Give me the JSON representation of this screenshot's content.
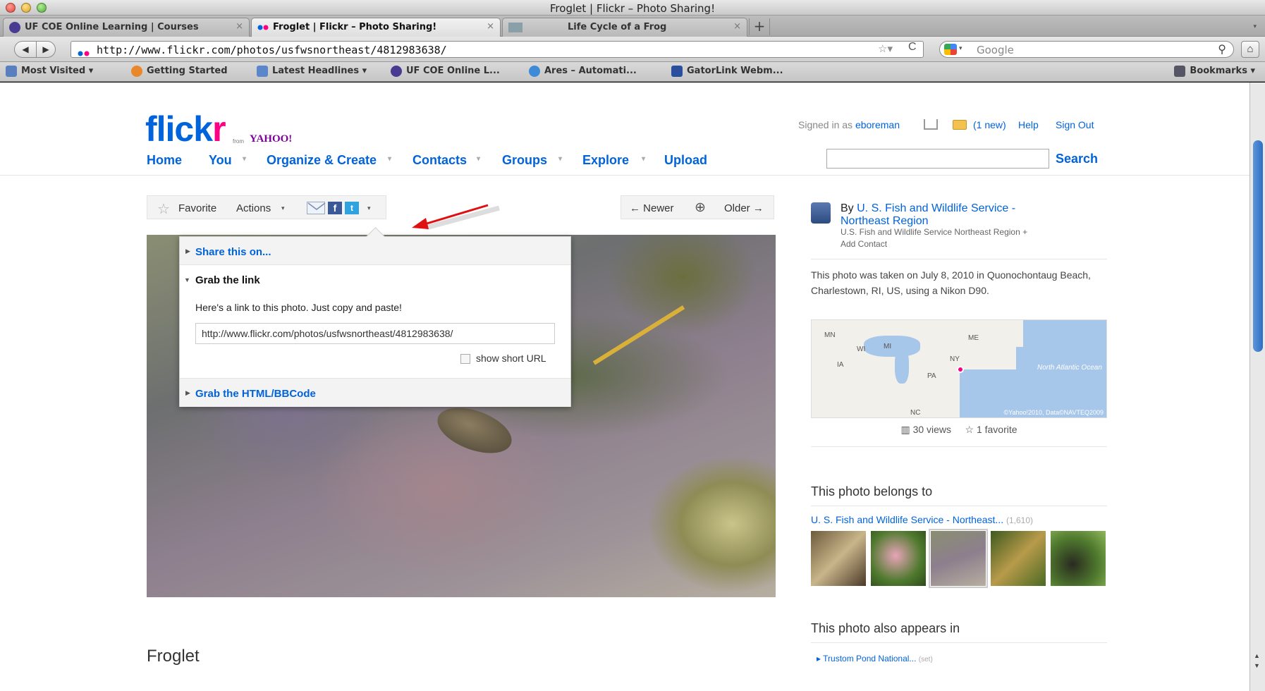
{
  "window": {
    "title": "Froglet | Flickr – Photo Sharing!"
  },
  "tabs": [
    {
      "label": "UF COE Online Learning | Courses",
      "close": "×"
    },
    {
      "label": "Froglet | Flickr – Photo Sharing!",
      "close": "×"
    },
    {
      "label": "Life Cycle of a Frog",
      "close": "×"
    }
  ],
  "tab_new": "+",
  "nav": {
    "back": "◀",
    "forward": "▶",
    "url": "http://www.flickr.com/photos/usfwsnortheast/4812983638/",
    "star": "☆▾",
    "reload": "C",
    "search_placeholder": "Google",
    "search_icon": "⚲",
    "home": "⌂"
  },
  "bookmarks": [
    {
      "label": "Most Visited ▾",
      "icon": "most-visited-icon",
      "color": "#5a7fbf"
    },
    {
      "label": "Getting Started",
      "icon": "firefox-icon",
      "color": "#e8872b"
    },
    {
      "label": "Latest Headlines ▾",
      "icon": "rss-icon",
      "color": "#5b86c9"
    },
    {
      "label": "UF COE Online L...",
      "icon": "uf-coe-icon",
      "color": "#4a3b92"
    },
    {
      "label": "Ares – Automati...",
      "icon": "ares-icon",
      "color": "#3d8ad8"
    },
    {
      "label": "GatorLink Webm...",
      "icon": "uf-icon",
      "color": "#2a4f9e"
    }
  ],
  "bookmarks_menu": "Bookmarks ▾",
  "flickr": {
    "logo_a": "flick",
    "logo_b": "r",
    "logo_from": "from",
    "logo_yahoo": "YAHOO!",
    "nav": [
      "Home",
      "You",
      "Organize & Create",
      "Contacts",
      "Groups",
      "Explore",
      "Upload"
    ],
    "signed_in_prefix": "Signed in as",
    "user": "eboreman",
    "new_mail": "(1 new)",
    "help": "Help",
    "sign_out": "Sign Out",
    "search_button": "Search"
  },
  "actionbar": {
    "favorite": "Favorite",
    "actions": "Actions",
    "facebook": "f",
    "twitter": "t",
    "newer": "← Newer",
    "zoom": "⊕",
    "older": "Older →"
  },
  "share_panel": {
    "share_on": "Share this on...",
    "grab_link": "Grab the link",
    "desc": "Here's a link to this photo. Just copy and paste!",
    "url": "http://www.flickr.com/photos/usfwsnortheast/4812983638/",
    "short_url": "show short URL",
    "html_bbcode": "Grab the HTML/BBCode"
  },
  "photo": {
    "title": "Froglet"
  },
  "sidebar": {
    "by": "By",
    "owner_1": "U. S. Fish and Wildlife Service -",
    "owner_2": "Northeast Region",
    "owner_sub": "U.S. Fish and Wildlife Service Northeast Region  +",
    "add_contact": "Add Contact",
    "taken": "This photo was taken on July 8, 2010 in Quonochontaug Beach, Charlestown, RI, US, using a Nikon D90.",
    "map_labels": [
      "MN",
      "WI",
      "MI",
      "IA",
      "NY",
      "ME",
      "PA",
      "NC"
    ],
    "map_ocean": "North Atlantic Ocean",
    "map_copyright": "©Yahoo!2010, Data©NAVTEQ2009",
    "views": "30 views",
    "favorites": "☆ 1 favorite",
    "belongs_to": "This photo belongs to",
    "set_name": "U. S. Fish and Wildlife Service - Northeast...",
    "set_count": "(1,610)",
    "also_appears": "This photo also appears in",
    "appears_item": "Trustom Pond National...",
    "appears_tag": "(set)"
  }
}
